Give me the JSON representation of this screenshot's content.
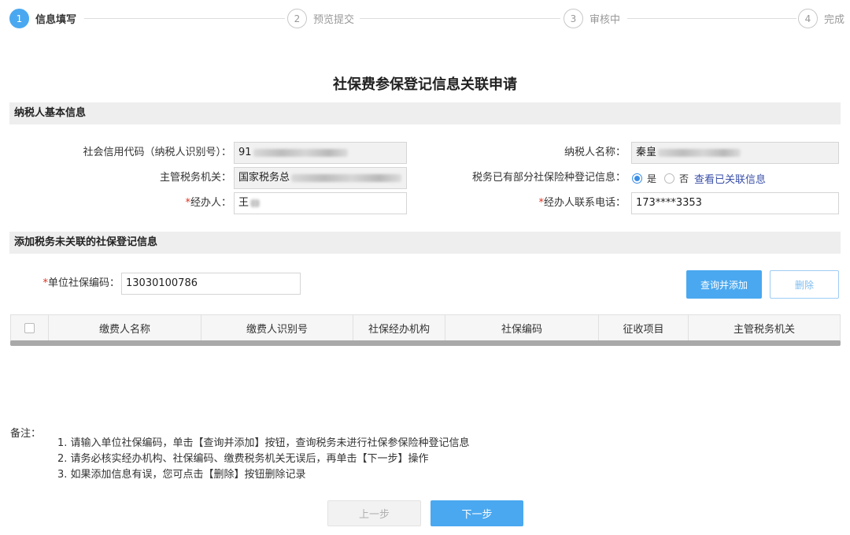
{
  "steps": [
    {
      "num": "1",
      "label": "信息填写"
    },
    {
      "num": "2",
      "label": "预览提交"
    },
    {
      "num": "3",
      "label": "审核中"
    },
    {
      "num": "4",
      "label": "完成"
    }
  ],
  "title": "社保费参保登记信息关联申请",
  "section1": {
    "title": "纳税人基本信息",
    "credit_code_label": "社会信用代码（纳税人识别号）：",
    "credit_code_value": "91",
    "taxpayer_name_label": "纳税人名称：",
    "taxpayer_name_value": "秦皇",
    "tax_authority_label": "主管税务机关：",
    "tax_authority_value": "国家税务总",
    "registered_label": "税务已有部分社保险种登记信息：",
    "radio_yes": "是",
    "radio_no": "否",
    "view_link": "查看已关联信息",
    "handler_label": "经办人：",
    "handler_value": "王",
    "phone_label": "经办人联系电话：",
    "phone_value": "173****3353"
  },
  "section2": {
    "title": "添加税务未关联的社保登记信息",
    "unit_code_label": "单位社保编码：",
    "unit_code_value": "13030100786",
    "query_add_button": "查询并添加",
    "delete_button": "删除"
  },
  "table": {
    "columns": [
      "缴费人名称",
      "缴费人识别号",
      "社保经办机构",
      "社保编码",
      "征收项目",
      "主管税务机关"
    ]
  },
  "notes": {
    "label": "备注：",
    "items": [
      "1. 请输入单位社保编码，单击【查询并添加】按钮，查询税务未进行社保参保险种登记信息",
      "2. 请务必核实经办机构、社保编码、缴费税务机关无误后，再单击【下一步】操作",
      "3. 如果添加信息有误，您可点击【删除】按钮删除记录"
    ]
  },
  "footer": {
    "prev_button": "上一步",
    "next_button": "下一步"
  },
  "colors": {
    "primary": "#4aa8f0",
    "required": "#e0301e",
    "link": "#3a50a8"
  }
}
